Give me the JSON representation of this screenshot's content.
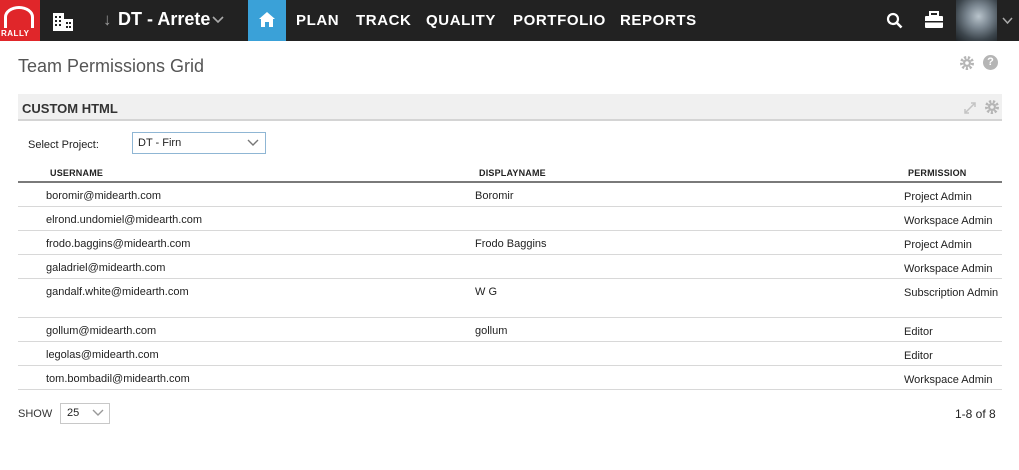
{
  "brand": {
    "logo_text": "RALLY",
    "accent": "#e0262a",
    "nav_bg": "#222222",
    "home_bg": "#3aa1d8"
  },
  "nav": {
    "project_name": "DT - Arrete",
    "items": [
      "PLAN",
      "TRACK",
      "QUALITY",
      "PORTFOLIO",
      "REPORTS"
    ],
    "icons": [
      "building-icon",
      "home-icon",
      "search-icon",
      "briefcase-icon",
      "avatar"
    ]
  },
  "page": {
    "title": "Team Permissions Grid"
  },
  "panel": {
    "title": "CUSTOM HTML"
  },
  "filter": {
    "label": "Select Project:",
    "value": "DT - Firn"
  },
  "table": {
    "columns": [
      "USERNAME",
      "DISPLAYNAME",
      "PERMISSION"
    ],
    "rows": [
      {
        "username": "boromir@midearth.com",
        "displayname": "Boromir",
        "permission": "Project Admin"
      },
      {
        "username": "elrond.undomiel@midearth.com",
        "displayname": "",
        "permission": "Workspace Admin"
      },
      {
        "username": "frodo.baggins@midearth.com",
        "displayname": "Frodo Baggins",
        "permission": "Project Admin"
      },
      {
        "username": "galadriel@midearth.com",
        "displayname": "",
        "permission": "Workspace Admin"
      },
      {
        "username": "gandalf.white@midearth.com",
        "displayname": "W G",
        "permission": "Subscription Admin"
      },
      {
        "username": "gollum@midearth.com",
        "displayname": "gollum",
        "permission": "Editor"
      },
      {
        "username": "legolas@midearth.com",
        "displayname": "",
        "permission": "Editor"
      },
      {
        "username": "tom.bombadil@midearth.com",
        "displayname": "",
        "permission": "Workspace Admin"
      }
    ]
  },
  "footer": {
    "show_label": "SHOW",
    "page_size": "25",
    "pager_text": "1-8 of 8"
  }
}
